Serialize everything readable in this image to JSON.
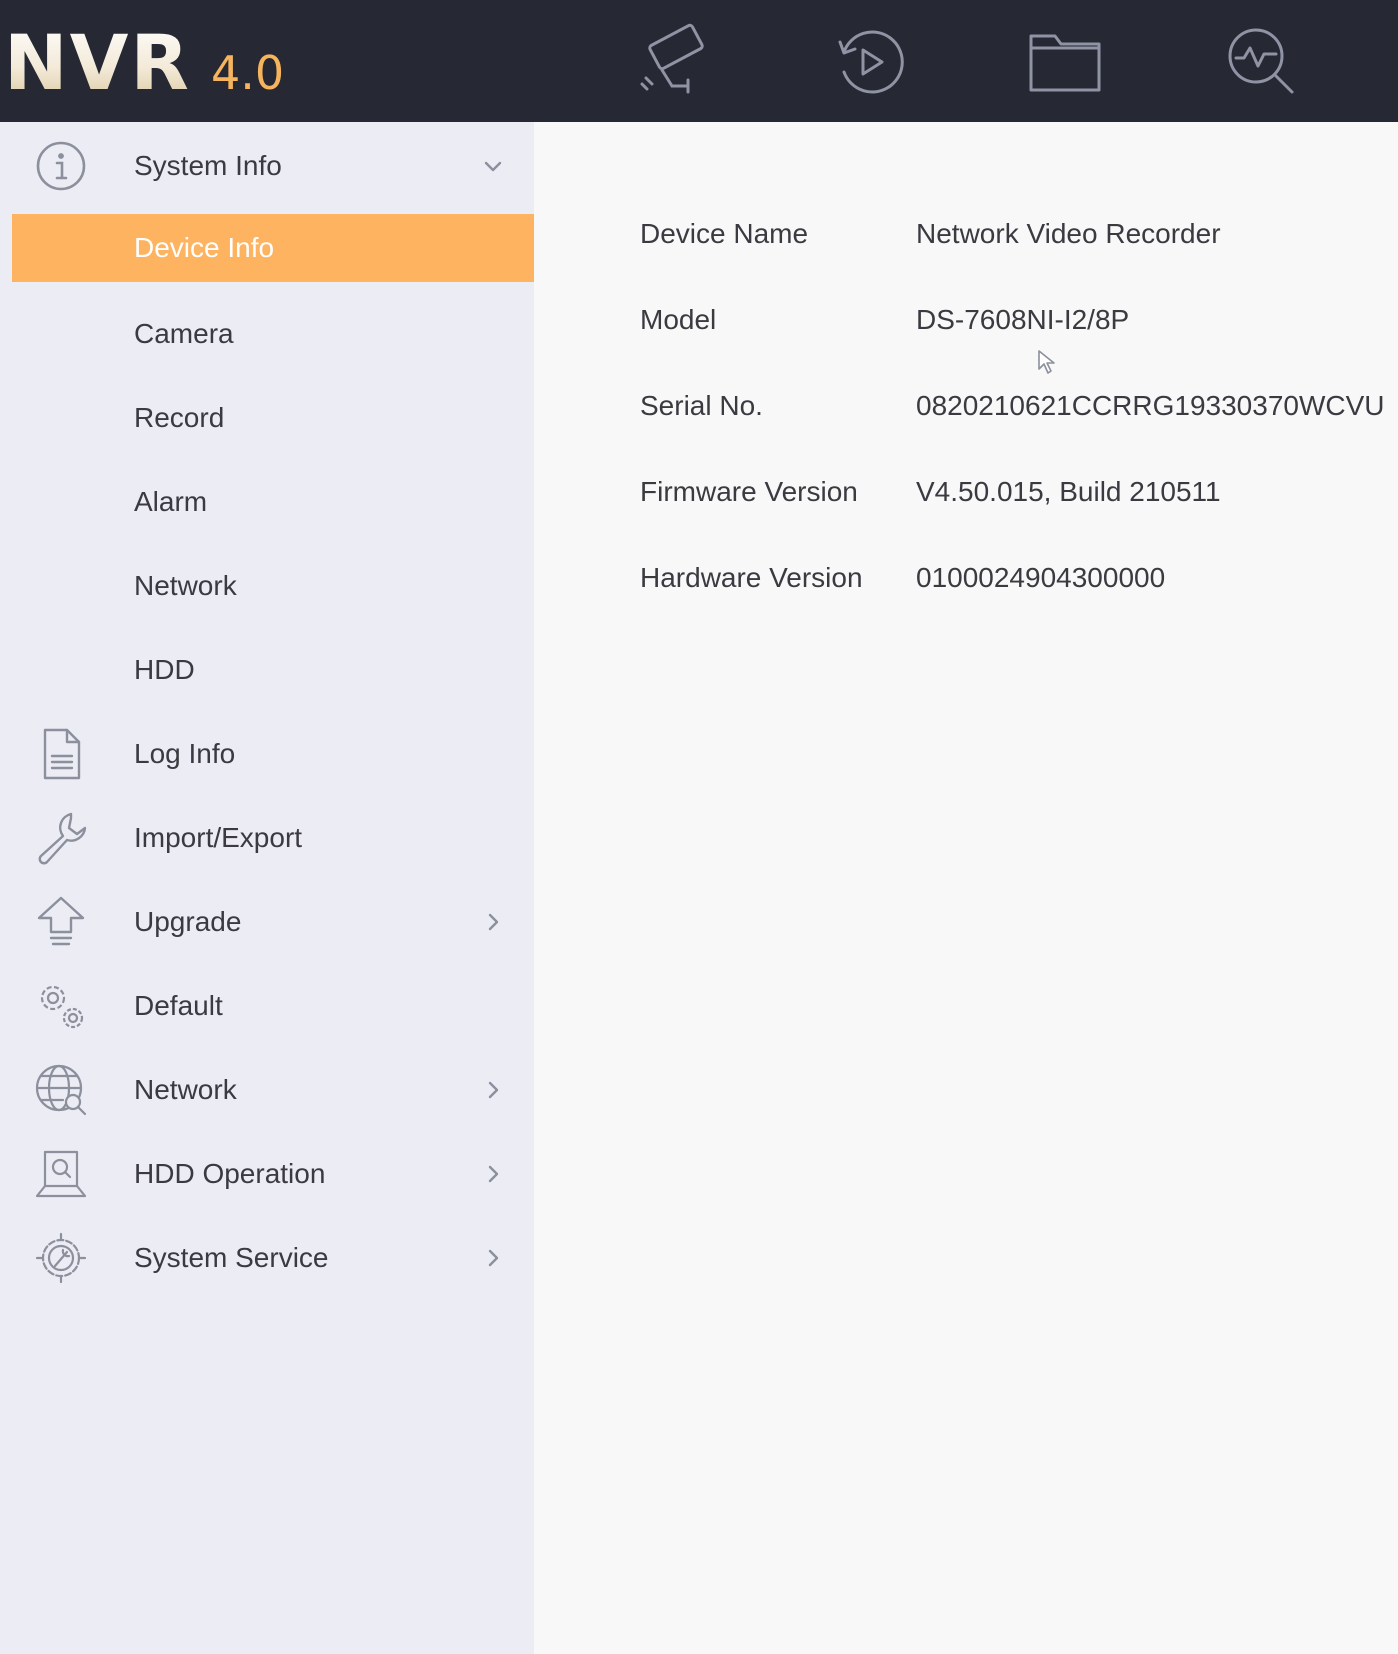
{
  "header": {
    "logo_main": "NVR",
    "logo_version": "4.0",
    "nav_icons": [
      "camera-icon",
      "playback-icon",
      "folder-icon",
      "smart-search-icon"
    ]
  },
  "sidebar": {
    "items": [
      {
        "label": "System Info",
        "icon": "info-icon",
        "arrow": "chevron-down-icon"
      },
      {
        "label": "Device Info",
        "active": true
      },
      {
        "label": "Camera"
      },
      {
        "label": "Record"
      },
      {
        "label": "Alarm"
      },
      {
        "label": "Network"
      },
      {
        "label": "HDD"
      },
      {
        "label": "Log Info",
        "icon": "document-icon"
      },
      {
        "label": "Import/Export",
        "icon": "wrench-icon"
      },
      {
        "label": "Upgrade",
        "icon": "upload-icon",
        "arrow": "chevron-right-icon"
      },
      {
        "label": "Default",
        "icon": "gears-icon"
      },
      {
        "label": "Network",
        "icon": "globe-search-icon",
        "arrow": "chevron-right-icon"
      },
      {
        "label": "HDD Operation",
        "icon": "hdd-icon",
        "arrow": "chevron-right-icon"
      },
      {
        "label": "System Service",
        "icon": "service-gear-icon",
        "arrow": "chevron-right-icon"
      }
    ]
  },
  "device_info": {
    "rows": [
      {
        "key": "Device Name",
        "value": "Network Video Recorder"
      },
      {
        "key": "Model",
        "value": "DS-7608NI-I2/8P"
      },
      {
        "key": "Serial No.",
        "value": "0820210621CCRRG19330370WCVU"
      },
      {
        "key": "Firmware Version",
        "value": "V4.50.015, Build 210511"
      },
      {
        "key": "Hardware Version",
        "value": "0100024904300000"
      }
    ]
  },
  "colors": {
    "header_bg": "#262834",
    "sidebar_bg": "#ebecf4",
    "content_bg": "#f8f8f9",
    "accent": "#fdb360",
    "logo_version": "#f6b45c"
  }
}
